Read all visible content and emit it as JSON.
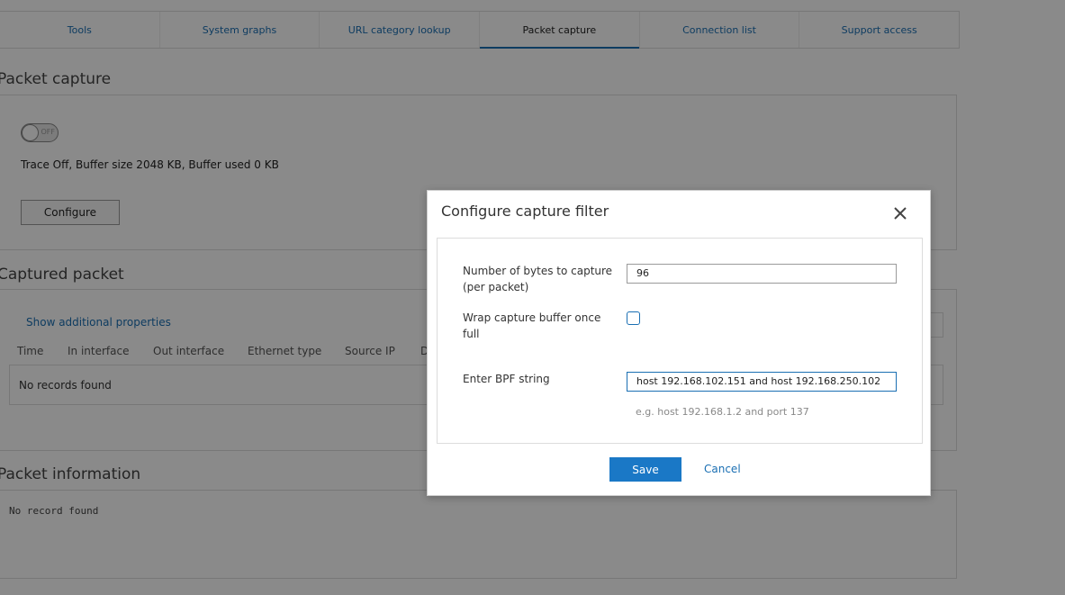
{
  "tabs": [
    {
      "label": "Tools",
      "active": false
    },
    {
      "label": "System graphs",
      "active": false
    },
    {
      "label": "URL category lookup",
      "active": false
    },
    {
      "label": "Packet capture",
      "active": true
    },
    {
      "label": "Connection list",
      "active": false
    },
    {
      "label": "Support access",
      "active": false
    }
  ],
  "packet_capture": {
    "title": "Packet capture",
    "toggle_label": "OFF",
    "status_text": "Trace Off, Buffer size 2048 KB, Buffer used 0 KB",
    "configure_label": "Configure"
  },
  "captured_packet": {
    "title": "Captured packet",
    "show_props_label": "Show additional properties",
    "columns": [
      "Time",
      "In interface",
      "Out interface",
      "Ethernet type",
      "Source IP",
      "D"
    ],
    "empty_text": "No records found"
  },
  "packet_information": {
    "title": "Packet information",
    "empty_text": "No record found"
  },
  "modal": {
    "title": "Configure capture filter",
    "bytes_label_line1": "Number of bytes to capture",
    "bytes_label_line2": "(per packet)",
    "bytes_value": "96",
    "wrap_label_line1": "Wrap capture buffer once",
    "wrap_label_line2": "full",
    "wrap_checked": false,
    "bpf_label": "Enter BPF string",
    "bpf_value": "host 192.168.102.151 and host 192.168.250.102",
    "bpf_hint": "e.g. host 192.168.1.2 and port 137",
    "save_label": "Save",
    "cancel_label": "Cancel"
  },
  "colors": {
    "accent": "#1a78c6",
    "link": "#1a6fb3",
    "overlay": "rgba(0,0,0,0.46)"
  }
}
